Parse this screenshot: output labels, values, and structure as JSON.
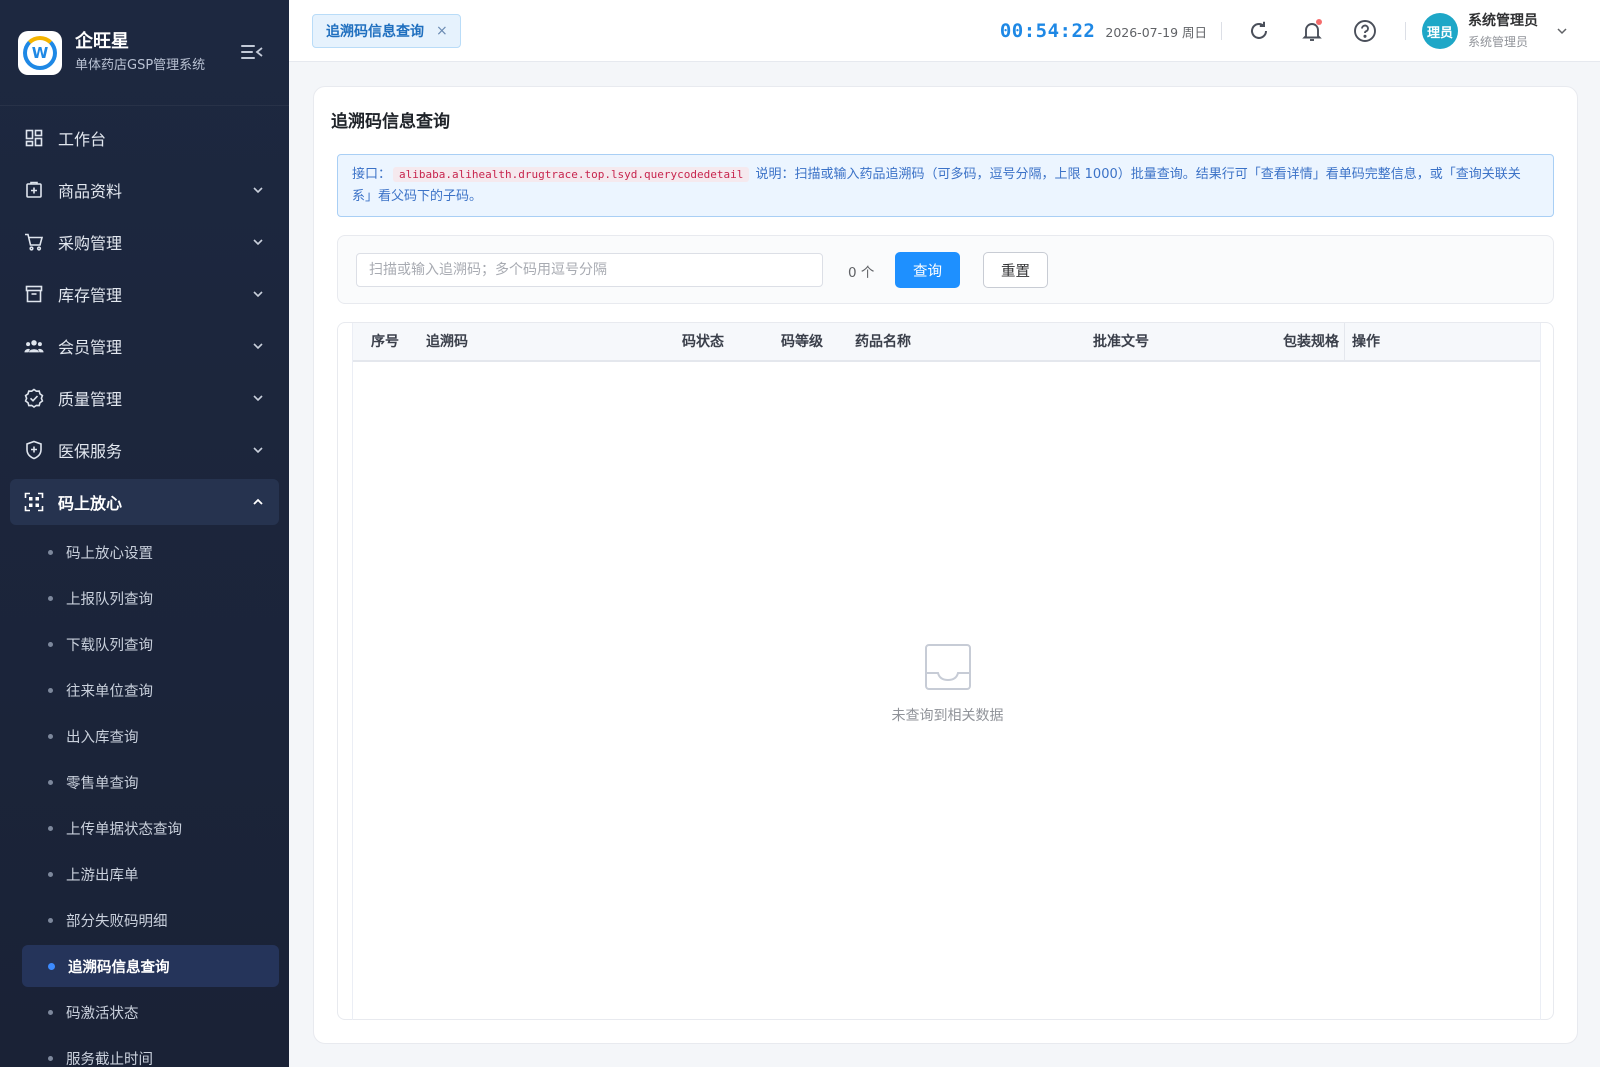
{
  "brand": {
    "name": "企旺星",
    "subtitle": "单体药店GSP管理系统",
    "logo_letter": "W"
  },
  "sidebar": {
    "items": [
      {
        "label": "工作台",
        "icon": "dashboard-icon"
      },
      {
        "label": "商品资料",
        "icon": "product-icon"
      },
      {
        "label": "采购管理",
        "icon": "cart-icon"
      },
      {
        "label": "库存管理",
        "icon": "inventory-icon"
      },
      {
        "label": "会员管理",
        "icon": "members-icon"
      },
      {
        "label": "质量管理",
        "icon": "quality-badge-icon"
      },
      {
        "label": "医保服务",
        "icon": "shield-plus-icon"
      },
      {
        "label": "码上放心",
        "icon": "scan-code-icon",
        "open": true
      }
    ],
    "sub_items": [
      "码上放心设置",
      "上报队列查询",
      "下载队列查询",
      "往来单位查询",
      "出入库查询",
      "零售单查询",
      "上传单据状态查询",
      "上游出库单",
      "部分失败码明细",
      "追溯码信息查询",
      "码激活状态",
      "服务截止时间"
    ],
    "active_sub": "追溯码信息查询"
  },
  "header": {
    "tab_label": "追溯码信息查询",
    "tab_close": "×",
    "clock": "00:54:22",
    "date": "2026-07-19 周日",
    "avatar_text": "理员",
    "user_name": "系统管理员",
    "user_role": "系统管理员"
  },
  "main": {
    "title": "追溯码信息查询",
    "notice": {
      "prefix": "接口：",
      "api": "alibaba.alihealth.drugtrace.top.lsyd.querycodedetail",
      "text": "说明：扫描或输入药品追溯码（可多码，逗号分隔，上限 1000）批量查询。结果行可「查看详情」看单码完整信息，或「查询关联关系」看父码下的子码。"
    },
    "search": {
      "placeholder": "扫描或输入追溯码；多个码用逗号分隔",
      "value": "",
      "count": "0 个",
      "query_label": "查询",
      "reset_label": "重置"
    },
    "table": {
      "columns": [
        "序号",
        "追溯码",
        "码状态",
        "码等级",
        "药品名称",
        "批准文号",
        "包装规格",
        "操作"
      ],
      "rows": [],
      "empty_text": "未查询到相关数据"
    }
  },
  "colors": {
    "sidebar_bg": "#1d2840",
    "accent": "#1e90ff",
    "clock": "#1e88e5",
    "notice_bg": "#ecf5ff"
  }
}
